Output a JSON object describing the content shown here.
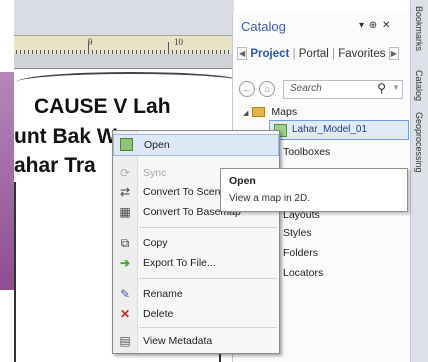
{
  "map": {
    "ruler_labels": [
      "9",
      "10"
    ],
    "title_lines": [
      "CAUSE V Lah",
      "unt Bak   Wa",
      "ahar Tra"
    ]
  },
  "catalog": {
    "title": "Catalog",
    "window_controls": "▾ ⊕ ✕",
    "tabs": [
      "Project",
      "Portal",
      "Favorites"
    ],
    "search_placeholder": "Search",
    "tree": {
      "maps_label": "Maps",
      "selected_map": "Lahar_Model_01",
      "nodes": [
        "Toolboxes",
        "Layouts",
        "Styles",
        "Folders",
        "Locators"
      ]
    }
  },
  "side_tabs": [
    "Bookmarks",
    "Catalog",
    "Geoprocessing"
  ],
  "context_menu": {
    "items": [
      {
        "label": "Open",
        "icon": "open-map-icon",
        "state": "highlighted"
      },
      {
        "label": "Sync",
        "icon": "sync-icon",
        "state": "disabled"
      },
      {
        "label": "Convert To Scene",
        "icon": "convert-scene-icon",
        "state": "normal"
      },
      {
        "label": "Convert To Basemap",
        "icon": "convert-basemap-icon",
        "state": "normal"
      },
      {
        "label": "Copy",
        "icon": "copy-icon",
        "state": "normal"
      },
      {
        "label": "Export To File...",
        "icon": "export-arrow-icon",
        "state": "normal"
      },
      {
        "label": "Rename",
        "icon": "rename-pencil-icon",
        "state": "normal"
      },
      {
        "label": "Delete",
        "icon": "delete-x-icon",
        "state": "normal"
      },
      {
        "label": "View Metadata",
        "icon": "metadata-icon",
        "state": "normal"
      }
    ]
  },
  "tooltip": {
    "title": "Open",
    "body": "View a map in 2D."
  },
  "colors": {
    "accent": "#3b5ea8",
    "highlight": "#dde8f6",
    "left_band": "#9a5da0"
  }
}
